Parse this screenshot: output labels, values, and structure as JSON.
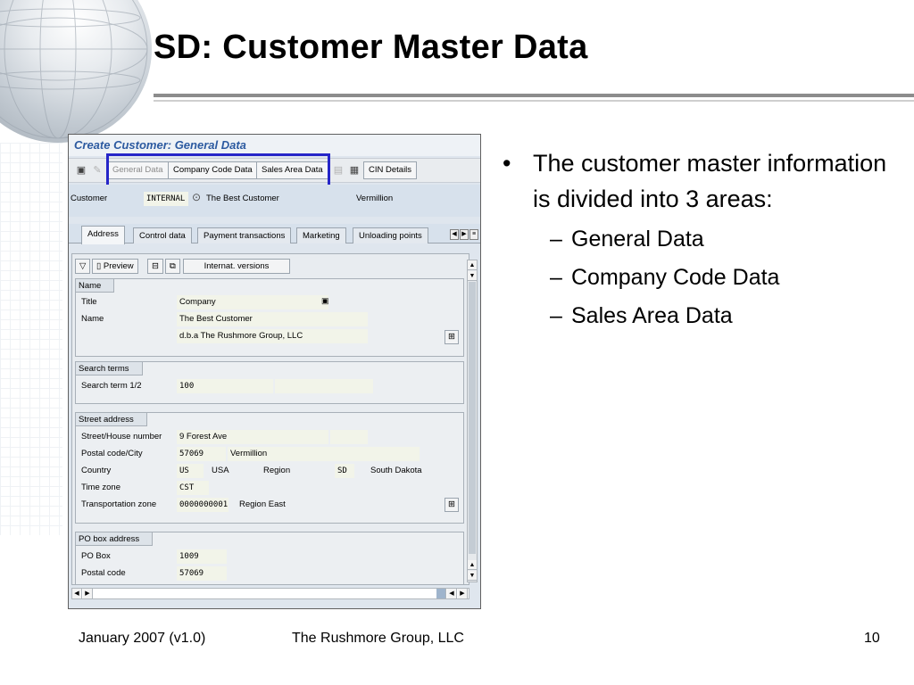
{
  "slide": {
    "title": "SD: Customer Master Data",
    "bullet": "The customer master information is divided into 3 areas:",
    "sub_bullets": [
      "General Data",
      "Company Code Data",
      "Sales Area Data"
    ],
    "footer_left": "January 2007 (v1.0)",
    "footer_center": "The Rushmore Group, LLC",
    "page_number": "10"
  },
  "sap": {
    "window_title": "Create Customer: General Data",
    "toolbar": {
      "general_data": "General Data",
      "company_code_data": "Company Code Data",
      "sales_area_data": "Sales Area Data",
      "cin_details": "CIN Details"
    },
    "customer": {
      "label": "Customer",
      "number": "INTERNAL",
      "name": "The Best Customer",
      "city": "Vermillion"
    },
    "tabs": [
      "Address",
      "Control data",
      "Payment transactions",
      "Marketing",
      "Unloading points"
    ],
    "subtoolbar": {
      "preview": "Preview",
      "internat_versions": "Internat. versions"
    },
    "name_group": {
      "header": "Name",
      "title_label": "Title",
      "title_value": "Company",
      "name_label": "Name",
      "name1": "The Best Customer",
      "name2": "d.b.a The Rushmore Group, LLC"
    },
    "search_group": {
      "header": "Search terms",
      "label": "Search term 1/2",
      "value1": "100",
      "value2": ""
    },
    "street_group": {
      "header": "Street address",
      "street_label": "Street/House number",
      "street_value": "9 Forest Ave",
      "postal_label": "Postal code/City",
      "postal_value": "57069",
      "city_value": "Vermillion",
      "country_label": "Country",
      "country_code": "US",
      "country_name": "USA",
      "region_label": "Region",
      "region_code": "SD",
      "region_name": "South Dakota",
      "timezone_label": "Time zone",
      "timezone_value": "CST",
      "transport_label": "Transportation zone",
      "transport_value": "0000000001",
      "transport_name": "Region East"
    },
    "pobox_group": {
      "header": "PO box address",
      "pobox_label": "PO Box",
      "pobox_value": "1009",
      "postal_label": "Postal code",
      "postal_value": "57069"
    }
  }
}
